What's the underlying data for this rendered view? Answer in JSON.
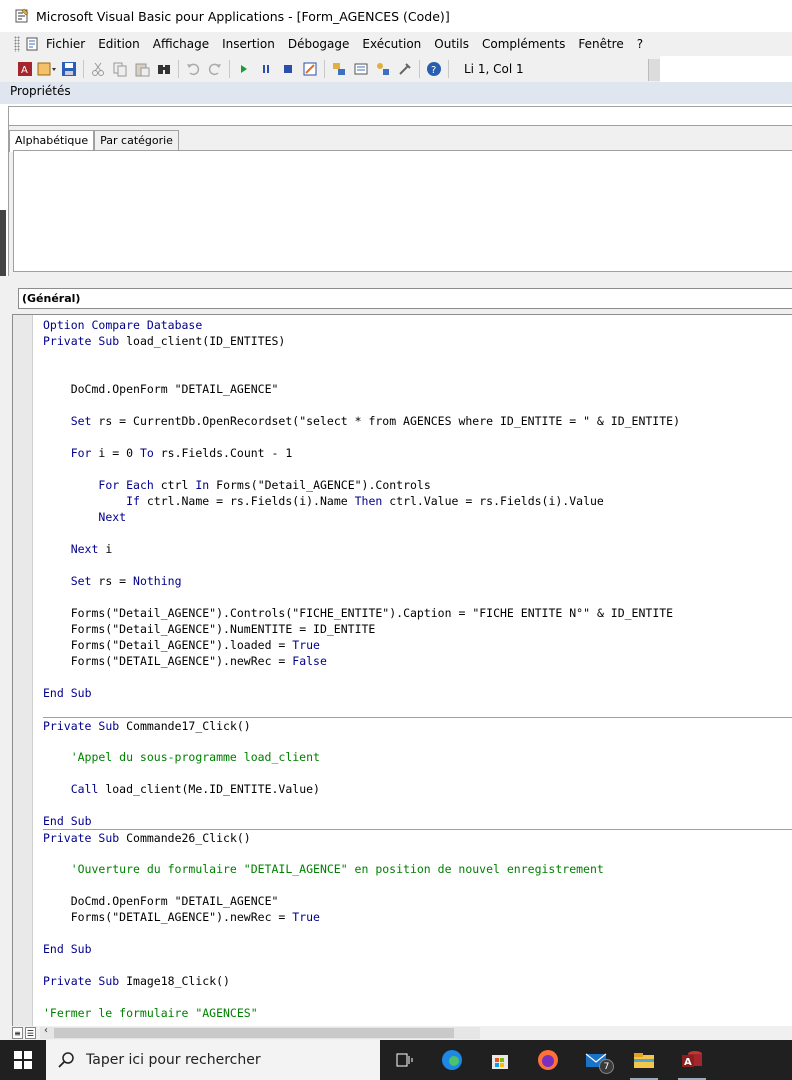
{
  "window": {
    "title": "Microsoft Visual Basic pour Applications - [Form_AGENCES (Code)]"
  },
  "menu": {
    "items": [
      "Fichier",
      "Edition",
      "Affichage",
      "Insertion",
      "Débogage",
      "Exécution",
      "Outils",
      "Compléments",
      "Fenêtre",
      "?"
    ]
  },
  "toolbar": {
    "buttons": [
      "view-access-icon",
      "insert-userform-icon",
      "save-icon",
      "cut-icon",
      "copy-icon",
      "paste-icon",
      "find-icon",
      "undo-icon",
      "redo-icon",
      "run-icon",
      "break-icon",
      "reset-icon",
      "design-mode-icon",
      "project-explorer-icon",
      "properties-icon",
      "object-browser-icon",
      "toolbox-icon",
      "help-icon"
    ],
    "status": "Li 1, Col 1"
  },
  "properties": {
    "header": "Propriétés",
    "tabs": [
      "Alphabétique",
      "Par catégorie"
    ]
  },
  "code": {
    "procedure": "(Général)",
    "lines": [
      "Option Compare Database",
      "Private Sub load_client(ID_ENTITES)",
      "",
      "",
      "    DoCmd.OpenForm \"DETAIL_AGENCE\"",
      "",
      "    Set rs = CurrentDb.OpenRecordset(\"select * from AGENCES where ID_ENTITE = \" & ID_ENTITE)",
      "",
      "    For i = 0 To rs.Fields.Count - 1",
      "",
      "        For Each ctrl In Forms(\"Detail_AGENCE\").Controls",
      "            If ctrl.Name = rs.Fields(i).Name Then ctrl.Value = rs.Fields(i).Value",
      "        Next",
      "",
      "    Next i",
      "",
      "    Set rs = Nothing",
      "",
      "    Forms(\"Detail_AGENCE\").Controls(\"FICHE_ENTITE\").Caption = \"FICHE ENTITE N°\" & ID_ENTITE",
      "    Forms(\"Detail_AGENCE\").NumENTITE = ID_ENTITE",
      "    Forms(\"Detail_AGENCE\").loaded = True",
      "    Forms(\"DETAIL_AGENCE\").newRec = False",
      "",
      "End Sub",
      "",
      "Private Sub Commande17_Click()",
      "",
      "    'Appel du sous-programme load_client",
      "",
      "    Call load_client(Me.ID_ENTITE.Value)",
      "",
      "End Sub",
      "Private Sub Commande26_Click()",
      "",
      "    'Ouverture du formulaire \"DETAIL_AGENCE\" en position de nouvel enregistrement",
      "",
      "    DoCmd.OpenForm \"DETAIL_AGENCE\"",
      "    Forms(\"DETAIL_AGENCE\").newRec = True",
      "",
      "End Sub",
      "",
      "Private Sub Image18_Click()",
      "",
      "'Fermer le formulaire \"AGENCES\""
    ]
  },
  "taskbar": {
    "search_placeholder": "Taper ici pour rechercher",
    "apps": [
      "task-view-icon",
      "edge-icon",
      "store-icon",
      "firefox-icon",
      "mail-icon",
      "file-explorer-icon",
      "access-icon"
    ],
    "mail_badge": "7"
  },
  "colors": {
    "keyword": "#00008b",
    "comment": "#008000",
    "props_header": "#dfe6ef",
    "taskbar": "#202020"
  }
}
